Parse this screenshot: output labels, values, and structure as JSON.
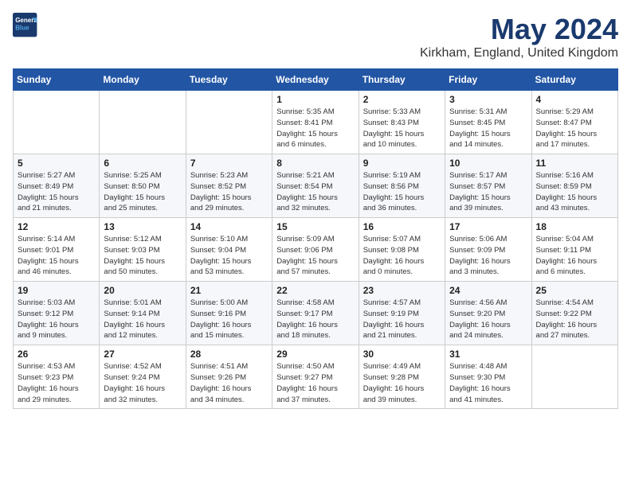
{
  "logo": {
    "line1": "General",
    "line2": "Blue"
  },
  "title": "May 2024",
  "location": "Kirkham, England, United Kingdom",
  "days_of_week": [
    "Sunday",
    "Monday",
    "Tuesday",
    "Wednesday",
    "Thursday",
    "Friday",
    "Saturday"
  ],
  "weeks": [
    [
      {
        "num": "",
        "info": ""
      },
      {
        "num": "",
        "info": ""
      },
      {
        "num": "",
        "info": ""
      },
      {
        "num": "1",
        "info": "Sunrise: 5:35 AM\nSunset: 8:41 PM\nDaylight: 15 hours\nand 6 minutes."
      },
      {
        "num": "2",
        "info": "Sunrise: 5:33 AM\nSunset: 8:43 PM\nDaylight: 15 hours\nand 10 minutes."
      },
      {
        "num": "3",
        "info": "Sunrise: 5:31 AM\nSunset: 8:45 PM\nDaylight: 15 hours\nand 14 minutes."
      },
      {
        "num": "4",
        "info": "Sunrise: 5:29 AM\nSunset: 8:47 PM\nDaylight: 15 hours\nand 17 minutes."
      }
    ],
    [
      {
        "num": "5",
        "info": "Sunrise: 5:27 AM\nSunset: 8:49 PM\nDaylight: 15 hours\nand 21 minutes."
      },
      {
        "num": "6",
        "info": "Sunrise: 5:25 AM\nSunset: 8:50 PM\nDaylight: 15 hours\nand 25 minutes."
      },
      {
        "num": "7",
        "info": "Sunrise: 5:23 AM\nSunset: 8:52 PM\nDaylight: 15 hours\nand 29 minutes."
      },
      {
        "num": "8",
        "info": "Sunrise: 5:21 AM\nSunset: 8:54 PM\nDaylight: 15 hours\nand 32 minutes."
      },
      {
        "num": "9",
        "info": "Sunrise: 5:19 AM\nSunset: 8:56 PM\nDaylight: 15 hours\nand 36 minutes."
      },
      {
        "num": "10",
        "info": "Sunrise: 5:17 AM\nSunset: 8:57 PM\nDaylight: 15 hours\nand 39 minutes."
      },
      {
        "num": "11",
        "info": "Sunrise: 5:16 AM\nSunset: 8:59 PM\nDaylight: 15 hours\nand 43 minutes."
      }
    ],
    [
      {
        "num": "12",
        "info": "Sunrise: 5:14 AM\nSunset: 9:01 PM\nDaylight: 15 hours\nand 46 minutes."
      },
      {
        "num": "13",
        "info": "Sunrise: 5:12 AM\nSunset: 9:03 PM\nDaylight: 15 hours\nand 50 minutes."
      },
      {
        "num": "14",
        "info": "Sunrise: 5:10 AM\nSunset: 9:04 PM\nDaylight: 15 hours\nand 53 minutes."
      },
      {
        "num": "15",
        "info": "Sunrise: 5:09 AM\nSunset: 9:06 PM\nDaylight: 15 hours\nand 57 minutes."
      },
      {
        "num": "16",
        "info": "Sunrise: 5:07 AM\nSunset: 9:08 PM\nDaylight: 16 hours\nand 0 minutes."
      },
      {
        "num": "17",
        "info": "Sunrise: 5:06 AM\nSunset: 9:09 PM\nDaylight: 16 hours\nand 3 minutes."
      },
      {
        "num": "18",
        "info": "Sunrise: 5:04 AM\nSunset: 9:11 PM\nDaylight: 16 hours\nand 6 minutes."
      }
    ],
    [
      {
        "num": "19",
        "info": "Sunrise: 5:03 AM\nSunset: 9:12 PM\nDaylight: 16 hours\nand 9 minutes."
      },
      {
        "num": "20",
        "info": "Sunrise: 5:01 AM\nSunset: 9:14 PM\nDaylight: 16 hours\nand 12 minutes."
      },
      {
        "num": "21",
        "info": "Sunrise: 5:00 AM\nSunset: 9:16 PM\nDaylight: 16 hours\nand 15 minutes."
      },
      {
        "num": "22",
        "info": "Sunrise: 4:58 AM\nSunset: 9:17 PM\nDaylight: 16 hours\nand 18 minutes."
      },
      {
        "num": "23",
        "info": "Sunrise: 4:57 AM\nSunset: 9:19 PM\nDaylight: 16 hours\nand 21 minutes."
      },
      {
        "num": "24",
        "info": "Sunrise: 4:56 AM\nSunset: 9:20 PM\nDaylight: 16 hours\nand 24 minutes."
      },
      {
        "num": "25",
        "info": "Sunrise: 4:54 AM\nSunset: 9:22 PM\nDaylight: 16 hours\nand 27 minutes."
      }
    ],
    [
      {
        "num": "26",
        "info": "Sunrise: 4:53 AM\nSunset: 9:23 PM\nDaylight: 16 hours\nand 29 minutes."
      },
      {
        "num": "27",
        "info": "Sunrise: 4:52 AM\nSunset: 9:24 PM\nDaylight: 16 hours\nand 32 minutes."
      },
      {
        "num": "28",
        "info": "Sunrise: 4:51 AM\nSunset: 9:26 PM\nDaylight: 16 hours\nand 34 minutes."
      },
      {
        "num": "29",
        "info": "Sunrise: 4:50 AM\nSunset: 9:27 PM\nDaylight: 16 hours\nand 37 minutes."
      },
      {
        "num": "30",
        "info": "Sunrise: 4:49 AM\nSunset: 9:28 PM\nDaylight: 16 hours\nand 39 minutes."
      },
      {
        "num": "31",
        "info": "Sunrise: 4:48 AM\nSunset: 9:30 PM\nDaylight: 16 hours\nand 41 minutes."
      },
      {
        "num": "",
        "info": ""
      }
    ]
  ]
}
